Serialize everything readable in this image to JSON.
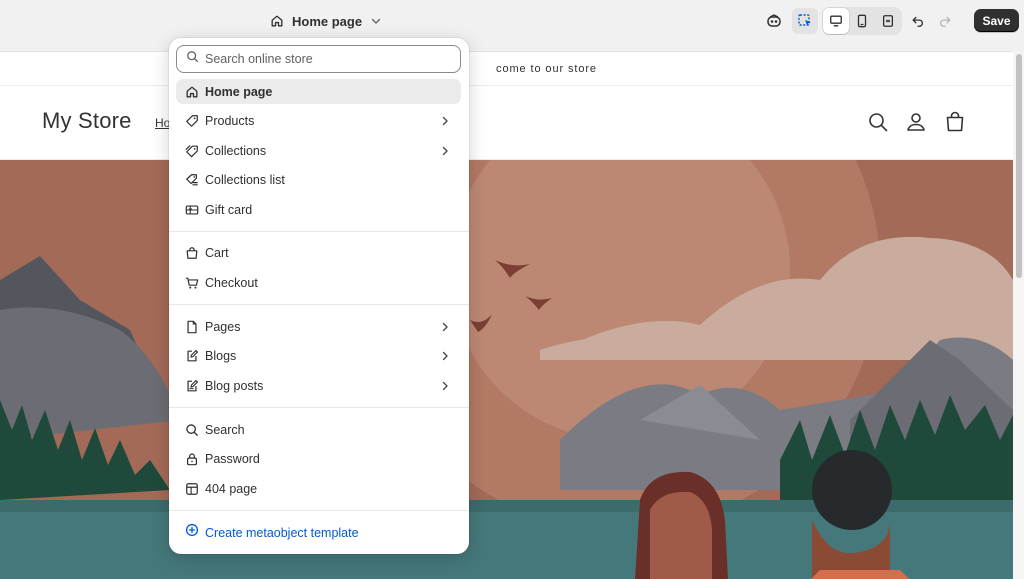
{
  "editor": {
    "page_selector_label": "Home page",
    "save_label": "Save"
  },
  "dropdown": {
    "search_placeholder": "Search online store",
    "group1": [
      {
        "label": "Home page",
        "icon": "home-icon",
        "selected": true,
        "chevron": false
      },
      {
        "label": "Products",
        "icon": "tag-icon",
        "chevron": true
      },
      {
        "label": "Collections",
        "icon": "collection-icon",
        "chevron": true
      },
      {
        "label": "Collections list",
        "icon": "collection-list-icon",
        "chevron": false
      },
      {
        "label": "Gift card",
        "icon": "gift-card-icon",
        "chevron": false
      }
    ],
    "group2": [
      {
        "label": "Cart",
        "icon": "cart-icon"
      },
      {
        "label": "Checkout",
        "icon": "checkout-icon"
      }
    ],
    "group3": [
      {
        "label": "Pages",
        "icon": "page-icon",
        "chevron": true
      },
      {
        "label": "Blogs",
        "icon": "blog-icon",
        "chevron": true
      },
      {
        "label": "Blog posts",
        "icon": "blog-post-icon",
        "chevron": true
      }
    ],
    "group4": [
      {
        "label": "Search",
        "icon": "search-icon"
      },
      {
        "label": "Password",
        "icon": "lock-icon"
      },
      {
        "label": "404 page",
        "icon": "error-page-icon"
      }
    ],
    "create_label": "Create metaobject template"
  },
  "store": {
    "announcement": "come to our store",
    "logo": "My Store",
    "nav_home": "Ho"
  },
  "colors": {
    "accent_link": "#005bd3",
    "save_bg": "#303030"
  }
}
